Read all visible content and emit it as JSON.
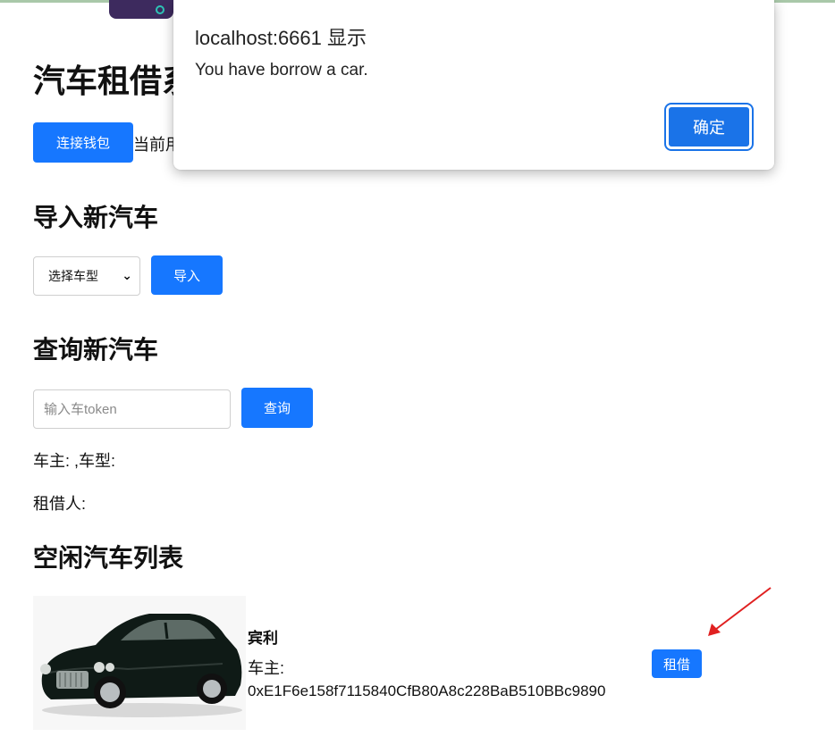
{
  "page": {
    "title": "汽车租借系统",
    "connect_button": "连接钱包",
    "account_text": "当前用户：",
    "import_section": {
      "heading": "导入新汽车",
      "select_value": "选择车型",
      "import_button": "导入"
    },
    "query_section": {
      "heading": "查询新汽车",
      "input_placeholder": "输入车token",
      "query_button": "查询",
      "owner_line": "车主: ,车型:",
      "borrower_line": "租借人:"
    },
    "list_section": {
      "heading": "空闲汽车列表",
      "cars": [
        {
          "name": "宾利",
          "owner_label": "车主:",
          "owner_address": "0xE1F6e158f7115840CfB80A8c228BaB510BBc9890",
          "rent_button": "租借"
        }
      ]
    }
  },
  "dialog": {
    "title": "localhost:6661 显示",
    "message": "You have borrow a car.",
    "ok_button": "确定"
  },
  "colors": {
    "primary": "#1677ff",
    "dialog_button": "#1a73e8",
    "arrow": "#e02020"
  }
}
